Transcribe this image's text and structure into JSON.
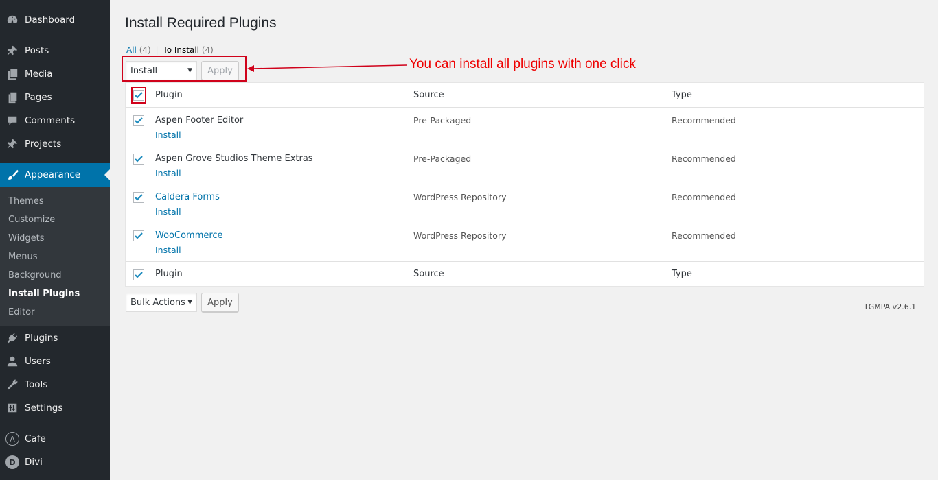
{
  "sidebar": {
    "items": [
      {
        "label": "Dashboard",
        "icon": "dashboard-icon"
      },
      {
        "label": "Posts",
        "icon": "pin-icon"
      },
      {
        "label": "Media",
        "icon": "media-icon"
      },
      {
        "label": "Pages",
        "icon": "pages-icon"
      },
      {
        "label": "Comments",
        "icon": "comment-icon"
      },
      {
        "label": "Projects",
        "icon": "pin-icon"
      },
      {
        "label": "Appearance",
        "icon": "paintbrush-icon"
      },
      {
        "label": "Plugins",
        "icon": "plug-icon"
      },
      {
        "label": "Users",
        "icon": "user-icon"
      },
      {
        "label": "Tools",
        "icon": "wrench-icon"
      },
      {
        "label": "Settings",
        "icon": "sliders-icon"
      },
      {
        "label": "Cafe",
        "icon": "letter-a-icon",
        "letter": "A"
      },
      {
        "label": "Divi",
        "icon": "letter-d-icon",
        "letter": "D"
      }
    ],
    "submenu": [
      "Themes",
      "Customize",
      "Widgets",
      "Menus",
      "Background",
      "Install Plugins",
      "Editor"
    ]
  },
  "page": {
    "title": "Install Required Plugins",
    "filters": {
      "all_label": "All",
      "all_count": "(4)",
      "separator": "|",
      "to_install_label": "To Install",
      "to_install_count": "(4)"
    },
    "top_bulk": {
      "selected": "Install",
      "apply": "Apply"
    },
    "bottom_bulk": {
      "selected": "Bulk Actions",
      "apply": "Apply"
    },
    "annotation": "You can install all plugins with one click",
    "version": "TGMPA v2.6.1"
  },
  "table": {
    "headers": {
      "plugin": "Plugin",
      "source": "Source",
      "type": "Type"
    },
    "rows": [
      {
        "name": "Aspen Footer Editor",
        "action": "Install",
        "source": "Pre-Packaged",
        "type": "Recommended",
        "checked": true
      },
      {
        "name": "Aspen Grove Studios Theme Extras",
        "action": "Install",
        "source": "Pre-Packaged",
        "type": "Recommended",
        "checked": true
      },
      {
        "name": "Caldera Forms",
        "action": "Install",
        "source": "WordPress Repository",
        "type": "Recommended",
        "checked": true
      },
      {
        "name": "WooCommerce",
        "action": "Install",
        "source": "WordPress Repository",
        "type": "Recommended",
        "checked": true
      }
    ]
  },
  "colors": {
    "sidebar_bg": "#23282d",
    "active_bg": "#0073aa",
    "link": "#0073aa",
    "annotation_red": "#e00000"
  }
}
